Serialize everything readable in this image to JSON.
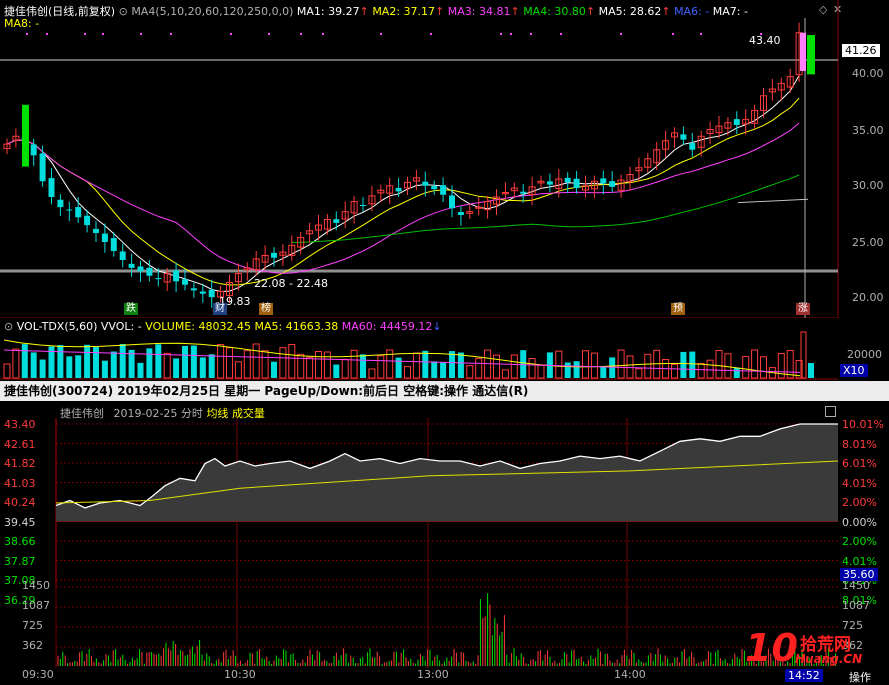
{
  "top_header": {
    "title": "捷佳伟创(日线,前复权)",
    "ma_param": "MA4(5,10,20,60,120,250,0,0)",
    "ma1": "MA1: 39.27",
    "ma2": "MA2: 37.17",
    "ma3": "MA3: 34.81",
    "ma4": "MA4: 30.80",
    "ma5": "MA5: 28.62",
    "ma6": "MA6: -",
    "ma7": "MA7: -",
    "ma8": "MA8: -",
    "arrow_up": "↑"
  },
  "price_axis": [
    "40.00",
    "35.00",
    "30.00",
    "25.00",
    "20.00"
  ],
  "price_badge": "41.26",
  "labels": {
    "high": "43.40",
    "low": "19.83",
    "range": "22.08 - 22.48",
    "tag_die": "跌",
    "tag_cai": "财",
    "tag_bang": "榜",
    "tag_yu": "预",
    "tag_zhang": "涨"
  },
  "vol_header": {
    "name": "VOL-TDX(5,60)",
    "vvol": "VVOL: -",
    "volume": "VOLUME: 48032.45",
    "ma5": "MA5: 41663.38",
    "ma60": "MA60: 44459.12",
    "arrow": "↓"
  },
  "vol_axis": [
    "20000",
    "X10"
  ],
  "status_bar": "捷佳伟创(300724) 2019年02月25日 星期一 PageUp/Down:前后日 空格键:操作 通达信(R)",
  "minute_header": {
    "name": "捷佳伟创",
    "date": "2019-02-25 分时",
    "avg": "均线",
    "vol": "成交量"
  },
  "minute_left_axis": [
    "43.40",
    "42.61",
    "41.82",
    "41.03",
    "40.24",
    "39.45",
    "38.66",
    "37.87",
    "37.08",
    "36.29"
  ],
  "minute_right_axis": [
    "10.01%",
    "8.01%",
    "6.01%",
    "4.01%",
    "2.00%",
    "0.00%",
    "2.00%",
    "4.01%",
    "6.01%",
    "8.01%"
  ],
  "minute_right_badge": "35.60",
  "minute_vol_axis": [
    "1450",
    "1087",
    "725",
    "362"
  ],
  "time_axis": [
    "09:30",
    "10:30",
    "13:00",
    "14:00"
  ],
  "corner_time": "14:52",
  "corner_op": "操作",
  "watermark": {
    "num": "10",
    "cn": "拾荒网",
    "en": "Huang.CN"
  },
  "colors": {
    "up": "#ff3b3b",
    "down": "#00e000",
    "ma1": "#ffffff",
    "ma2": "#ffff00",
    "ma3": "#ff40ff",
    "ma4": "#00c000",
    "ma5": "#c0c0c0"
  }
}
